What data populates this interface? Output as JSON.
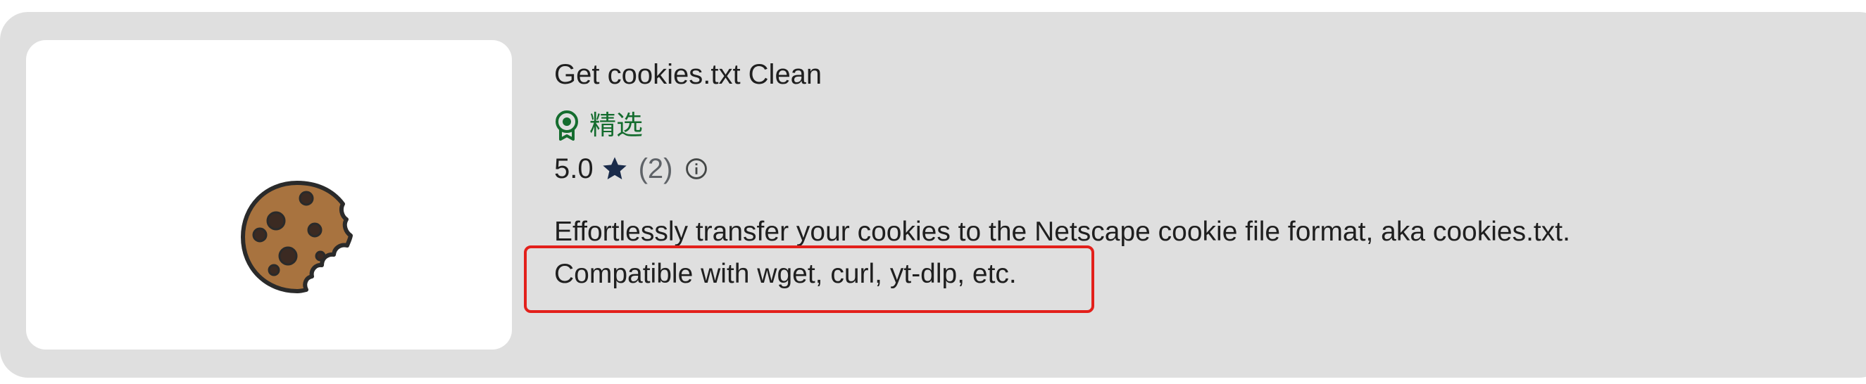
{
  "extension": {
    "name": "Get cookies.txt Clean",
    "badge_label": "精选",
    "badge_icon": "featured-badge-icon",
    "rating_value": "5.0",
    "rating_count": "(2)",
    "description_line1": "Effortlessly transfer your cookies to the Netscape cookie file format, aka cookies.txt.",
    "description_line2": "Compatible with wget, curl, yt-dlp, etc."
  },
  "colors": {
    "card_background": "#dfdfdf",
    "featured_green": "#146c2e",
    "star": "#1a2b4a",
    "highlight_red": "#e3201b"
  },
  "icons": {
    "thumbnail": "cookie-icon",
    "rating": "star-icon",
    "info": "info-icon"
  }
}
